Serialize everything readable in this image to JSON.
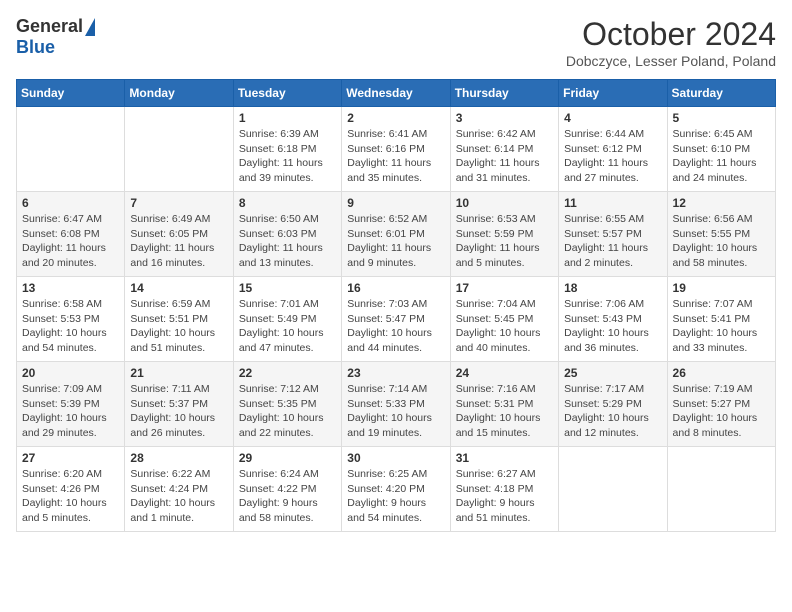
{
  "logo": {
    "general": "General",
    "blue": "Blue"
  },
  "title": "October 2024",
  "location": "Dobczyce, Lesser Poland, Poland",
  "days_of_week": [
    "Sunday",
    "Monday",
    "Tuesday",
    "Wednesday",
    "Thursday",
    "Friday",
    "Saturday"
  ],
  "weeks": [
    [
      {
        "day": "",
        "info": ""
      },
      {
        "day": "",
        "info": ""
      },
      {
        "day": "1",
        "info": "Sunrise: 6:39 AM\nSunset: 6:18 PM\nDaylight: 11 hours and 39 minutes."
      },
      {
        "day": "2",
        "info": "Sunrise: 6:41 AM\nSunset: 6:16 PM\nDaylight: 11 hours and 35 minutes."
      },
      {
        "day": "3",
        "info": "Sunrise: 6:42 AM\nSunset: 6:14 PM\nDaylight: 11 hours and 31 minutes."
      },
      {
        "day": "4",
        "info": "Sunrise: 6:44 AM\nSunset: 6:12 PM\nDaylight: 11 hours and 27 minutes."
      },
      {
        "day": "5",
        "info": "Sunrise: 6:45 AM\nSunset: 6:10 PM\nDaylight: 11 hours and 24 minutes."
      }
    ],
    [
      {
        "day": "6",
        "info": "Sunrise: 6:47 AM\nSunset: 6:08 PM\nDaylight: 11 hours and 20 minutes."
      },
      {
        "day": "7",
        "info": "Sunrise: 6:49 AM\nSunset: 6:05 PM\nDaylight: 11 hours and 16 minutes."
      },
      {
        "day": "8",
        "info": "Sunrise: 6:50 AM\nSunset: 6:03 PM\nDaylight: 11 hours and 13 minutes."
      },
      {
        "day": "9",
        "info": "Sunrise: 6:52 AM\nSunset: 6:01 PM\nDaylight: 11 hours and 9 minutes."
      },
      {
        "day": "10",
        "info": "Sunrise: 6:53 AM\nSunset: 5:59 PM\nDaylight: 11 hours and 5 minutes."
      },
      {
        "day": "11",
        "info": "Sunrise: 6:55 AM\nSunset: 5:57 PM\nDaylight: 11 hours and 2 minutes."
      },
      {
        "day": "12",
        "info": "Sunrise: 6:56 AM\nSunset: 5:55 PM\nDaylight: 10 hours and 58 minutes."
      }
    ],
    [
      {
        "day": "13",
        "info": "Sunrise: 6:58 AM\nSunset: 5:53 PM\nDaylight: 10 hours and 54 minutes."
      },
      {
        "day": "14",
        "info": "Sunrise: 6:59 AM\nSunset: 5:51 PM\nDaylight: 10 hours and 51 minutes."
      },
      {
        "day": "15",
        "info": "Sunrise: 7:01 AM\nSunset: 5:49 PM\nDaylight: 10 hours and 47 minutes."
      },
      {
        "day": "16",
        "info": "Sunrise: 7:03 AM\nSunset: 5:47 PM\nDaylight: 10 hours and 44 minutes."
      },
      {
        "day": "17",
        "info": "Sunrise: 7:04 AM\nSunset: 5:45 PM\nDaylight: 10 hours and 40 minutes."
      },
      {
        "day": "18",
        "info": "Sunrise: 7:06 AM\nSunset: 5:43 PM\nDaylight: 10 hours and 36 minutes."
      },
      {
        "day": "19",
        "info": "Sunrise: 7:07 AM\nSunset: 5:41 PM\nDaylight: 10 hours and 33 minutes."
      }
    ],
    [
      {
        "day": "20",
        "info": "Sunrise: 7:09 AM\nSunset: 5:39 PM\nDaylight: 10 hours and 29 minutes."
      },
      {
        "day": "21",
        "info": "Sunrise: 7:11 AM\nSunset: 5:37 PM\nDaylight: 10 hours and 26 minutes."
      },
      {
        "day": "22",
        "info": "Sunrise: 7:12 AM\nSunset: 5:35 PM\nDaylight: 10 hours and 22 minutes."
      },
      {
        "day": "23",
        "info": "Sunrise: 7:14 AM\nSunset: 5:33 PM\nDaylight: 10 hours and 19 minutes."
      },
      {
        "day": "24",
        "info": "Sunrise: 7:16 AM\nSunset: 5:31 PM\nDaylight: 10 hours and 15 minutes."
      },
      {
        "day": "25",
        "info": "Sunrise: 7:17 AM\nSunset: 5:29 PM\nDaylight: 10 hours and 12 minutes."
      },
      {
        "day": "26",
        "info": "Sunrise: 7:19 AM\nSunset: 5:27 PM\nDaylight: 10 hours and 8 minutes."
      }
    ],
    [
      {
        "day": "27",
        "info": "Sunrise: 6:20 AM\nSunset: 4:26 PM\nDaylight: 10 hours and 5 minutes."
      },
      {
        "day": "28",
        "info": "Sunrise: 6:22 AM\nSunset: 4:24 PM\nDaylight: 10 hours and 1 minute."
      },
      {
        "day": "29",
        "info": "Sunrise: 6:24 AM\nSunset: 4:22 PM\nDaylight: 9 hours and 58 minutes."
      },
      {
        "day": "30",
        "info": "Sunrise: 6:25 AM\nSunset: 4:20 PM\nDaylight: 9 hours and 54 minutes."
      },
      {
        "day": "31",
        "info": "Sunrise: 6:27 AM\nSunset: 4:18 PM\nDaylight: 9 hours and 51 minutes."
      },
      {
        "day": "",
        "info": ""
      },
      {
        "day": "",
        "info": ""
      }
    ]
  ]
}
